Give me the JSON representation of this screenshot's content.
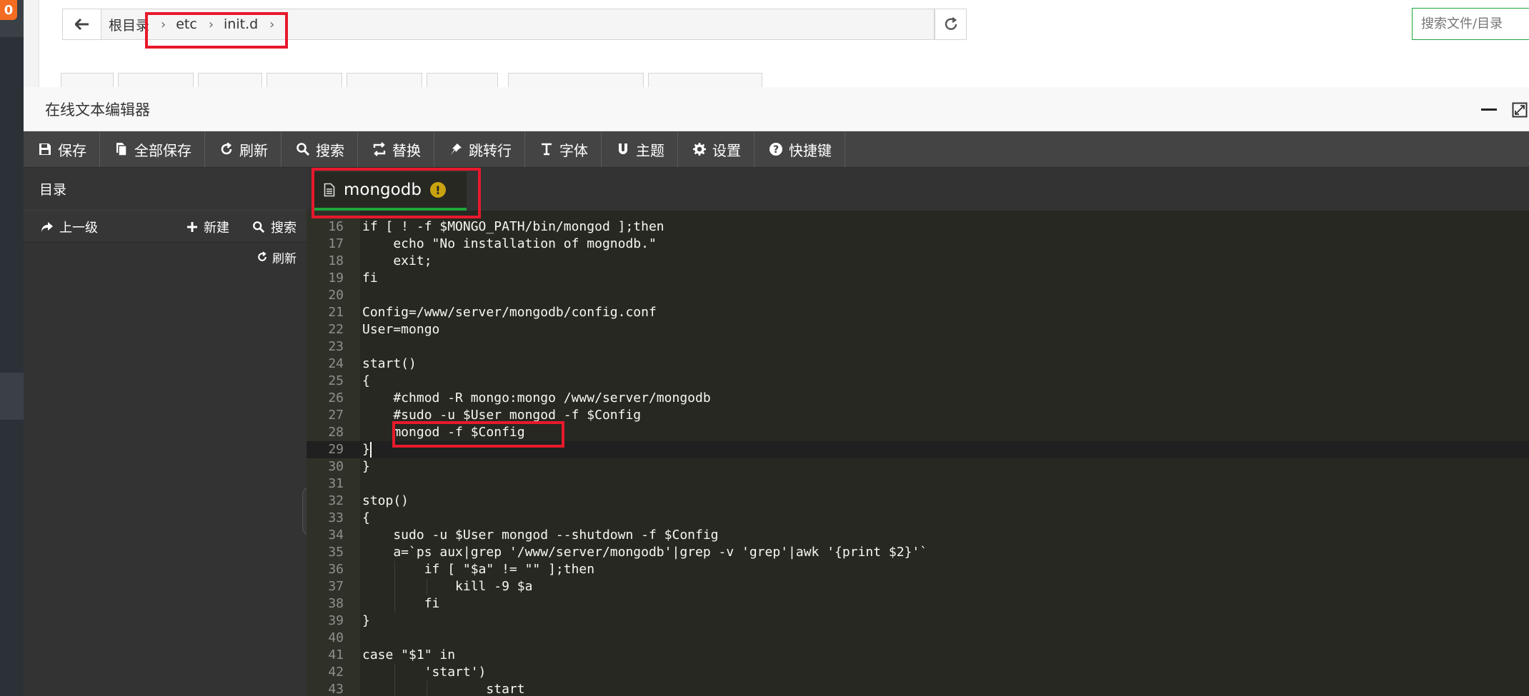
{
  "badge_text": "0",
  "file_manager": {
    "breadcrumb": [
      "根目录",
      "etc",
      "init.d"
    ],
    "search_placeholder": "搜索文件/目录"
  },
  "editor": {
    "title": "在线文本编辑器",
    "toolbar": [
      {
        "label": "保存",
        "icon": "save-icon"
      },
      {
        "label": "全部保存",
        "icon": "save-all-icon"
      },
      {
        "label": "刷新",
        "icon": "refresh-icon"
      },
      {
        "label": "搜索",
        "icon": "search-icon"
      },
      {
        "label": "替换",
        "icon": "replace-icon"
      },
      {
        "label": "跳转行",
        "icon": "jump-icon"
      },
      {
        "label": "字体",
        "icon": "font-icon"
      },
      {
        "label": "主题",
        "icon": "theme-icon"
      },
      {
        "label": "设置",
        "icon": "gear-icon"
      },
      {
        "label": "快捷键",
        "icon": "question-icon"
      }
    ],
    "sidebar": {
      "title": "目录",
      "up_label": "上一级",
      "new_label": "新建",
      "search_label": "搜索",
      "refresh_label": "刷新"
    },
    "active_tab": {
      "label": "mongodb",
      "icon": "file-icon",
      "status_icon": "warning-icon"
    },
    "current_line": 29,
    "lines": [
      {
        "num": "16",
        "text": "if [ ! -f $MONGO_PATH/bin/mongod ];then"
      },
      {
        "num": "17",
        "text": "    echo \"No installation of mognodb.\""
      },
      {
        "num": "18",
        "text": "    exit;"
      },
      {
        "num": "19",
        "text": "fi"
      },
      {
        "num": "20",
        "text": ""
      },
      {
        "num": "21",
        "text": "Config=/www/server/mongodb/config.conf"
      },
      {
        "num": "22",
        "text": "User=mongo"
      },
      {
        "num": "23",
        "text": ""
      },
      {
        "num": "24",
        "text": "start()"
      },
      {
        "num": "25",
        "text": "{"
      },
      {
        "num": "26",
        "text": "    #chmod -R mongo:mongo /www/server/mongodb"
      },
      {
        "num": "27",
        "text": "    #sudo -u $User mongod -f $Config"
      },
      {
        "num": "28",
        "text": "    mongod -f $Config"
      },
      {
        "num": "29",
        "text": "}"
      },
      {
        "num": "30",
        "text": "}"
      },
      {
        "num": "31",
        "text": ""
      },
      {
        "num": "32",
        "text": "stop()"
      },
      {
        "num": "33",
        "text": "{"
      },
      {
        "num": "34",
        "text": "    sudo -u $User mongod --shutdown -f $Config"
      },
      {
        "num": "35",
        "text": "    a=`ps aux|grep '/www/server/mongodb'|grep -v 'grep'|awk '{print $2}'`"
      },
      {
        "num": "36",
        "text": "        if [ \"$a\" != \"\" ];then"
      },
      {
        "num": "37",
        "text": "            kill -9 $a"
      },
      {
        "num": "38",
        "text": "        fi"
      },
      {
        "num": "39",
        "text": "}"
      },
      {
        "num": "40",
        "text": ""
      },
      {
        "num": "41",
        "text": "case \"$1\" in"
      },
      {
        "num": "42",
        "text": "        'start')"
      },
      {
        "num": "43",
        "text": "                start"
      }
    ]
  }
}
